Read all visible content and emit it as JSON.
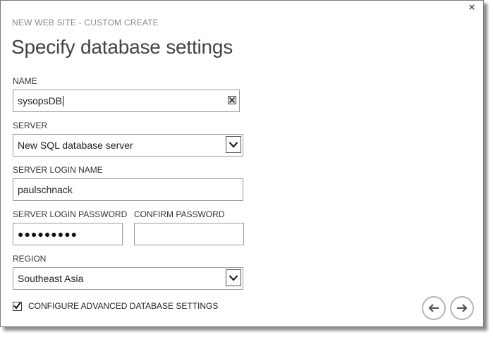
{
  "dialog": {
    "close_glyph": "×",
    "wizard_step": "NEW WEB SITE - CUSTOM CREATE",
    "title": "Specify database settings"
  },
  "form": {
    "name": {
      "label": "NAME",
      "value": "sysopsDB"
    },
    "server": {
      "label": "SERVER",
      "selected": "New SQL database server"
    },
    "server_login_name": {
      "label": "SERVER LOGIN NAME",
      "value": "paulschnack"
    },
    "server_login_password": {
      "label": "SERVER LOGIN PASSWORD",
      "masked_value": "●●●●●●●●●"
    },
    "confirm_password": {
      "label": "CONFIRM PASSWORD",
      "value": ""
    },
    "region": {
      "label": "REGION",
      "selected": "Southeast Asia"
    },
    "advanced": {
      "label": "CONFIGURE ADVANCED DATABASE SETTINGS",
      "checked": true
    }
  },
  "navigation": {
    "back_icon": "arrow-left-icon",
    "next_icon": "arrow-right-icon"
  },
  "colors": {
    "label": "#333333",
    "muted": "#8a8a8a",
    "title": "#444444",
    "border": "#9a9a9a",
    "nav_ring": "#b4b4b4"
  }
}
